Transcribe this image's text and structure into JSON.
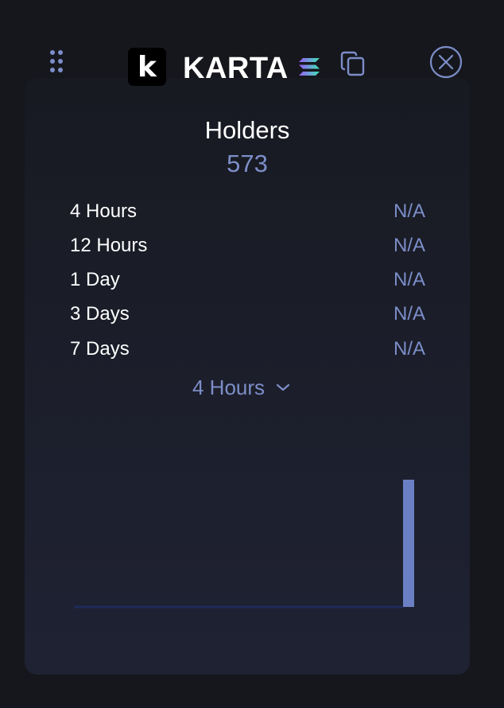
{
  "header": {
    "logo_letter": "k",
    "token_name": "KARTA",
    "chain_icon": "solana-icon",
    "copy_icon": "copy-icon",
    "close_icon": "close-circle-icon",
    "drag_icon": "drag-handle-icon"
  },
  "holders": {
    "title": "Holders",
    "count": "573"
  },
  "periods": [
    {
      "label": "4 Hours",
      "value": "N/A"
    },
    {
      "label": "12 Hours",
      "value": "N/A"
    },
    {
      "label": "1 Day",
      "value": "N/A"
    },
    {
      "label": "3 Days",
      "value": "N/A"
    },
    {
      "label": "7 Days",
      "value": "N/A"
    }
  ],
  "period_select": {
    "selected": "4 Hours"
  },
  "colors": {
    "accent": "#7c8ec8",
    "bar": "#6b7fc4",
    "baseline": "#1e2a5a",
    "background": "#16171d"
  },
  "chart_data": {
    "type": "bar",
    "values": [
      0,
      0,
      0,
      0,
      0,
      0,
      0,
      0,
      0,
      0,
      0,
      0,
      0,
      0,
      0,
      0,
      0,
      0,
      0,
      0,
      0,
      0,
      0,
      0,
      0,
      0,
      0,
      0,
      573
    ],
    "ylim": [
      0,
      573
    ],
    "grid": false
  }
}
